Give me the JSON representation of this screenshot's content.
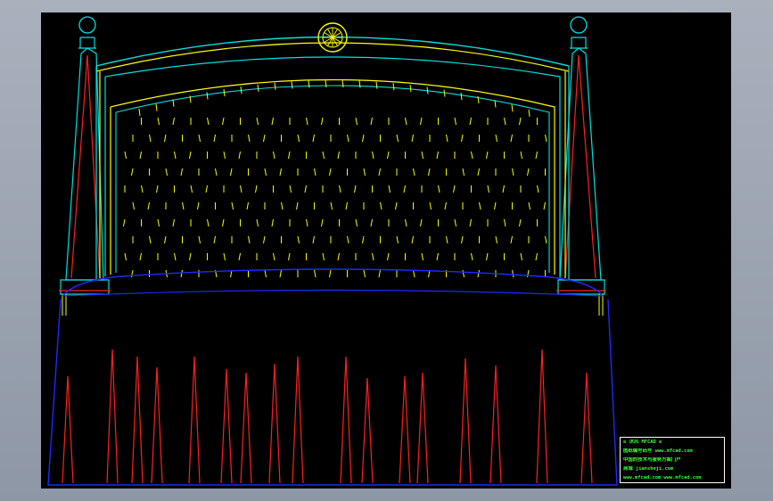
{
  "colors": {
    "background": "#000000",
    "frame": "#00e0e0",
    "yellow": "#ffff00",
    "red": "#ff0000",
    "blue": "#1a2cff",
    "stamp_text": "#33ff33",
    "stamp_border": "#ffffff"
  },
  "drawing": {
    "subject": "",
    "stamp": {
      "lines": [
        "≡ 沐风 MFCAD ≡",
        "图纸编号码号   www.mfcad.com",
        "中国的技术与服务方案门户",
        "商城 jiansheji.com",
        "www.mfcad.com  www.mfcad.com"
      ]
    }
  }
}
